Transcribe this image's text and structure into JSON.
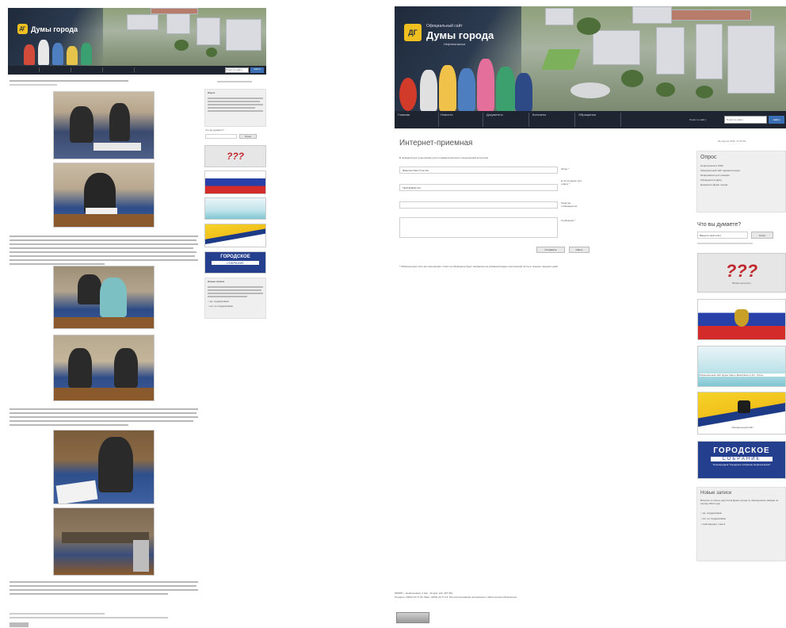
{
  "left": {
    "header": {
      "title": "Думы города",
      "logo_text": "ДГ"
    },
    "nav": {
      "search_placeholder": "Поиск по сайту",
      "search_button": "Найти"
    },
    "sidebar": {
      "block1_title": "Опрос",
      "poll_title": "Что вы думаете?",
      "poll_button": "Голос",
      "ad_question": "???",
      "ad_city_line1": "ГОРОДСКОЕ",
      "ad_city_line2": "СОБРАНИЕ",
      "news_title": "Новые записи",
      "radio_1": "да, поддерживаю",
      "radio_2": "нет, не поддерживаю"
    }
  },
  "right": {
    "header": {
      "subtitle": "Официальный сайт",
      "title": "Думы города",
      "sub2": "Нефтеюганска",
      "logo_text": "ДГ"
    },
    "nav": {
      "items": [
        "Главная",
        "Новости",
        "Документы",
        "Контакты",
        "Обращения"
      ],
      "search_label": "Поиск по сайту:",
      "search_placeholder": "Поиск по сайту",
      "search_button": "Найти"
    },
    "page": {
      "title": "Интернет-приемная",
      "date": "03 апреля 2015, 17:45:36",
      "intro": "В приемной доступны формы для отправки вопросов и предложений депутатам",
      "field_name_value": "Фамилия Имя Отчество",
      "field_email_value": "TEXT@MAIL.RU",
      "label_name": "Автор *",
      "label_email": "Е-почта адрес для ответа *",
      "label_subject": "Тема (не отображается)",
      "label_message": "Сообщение *",
      "btn_send": "Отправить",
      "btn_reset": "Сброс",
      "note": "* Обязательные поля для заполнения. Ответ на обращение будет направлен на указанный адрес электронной почты в течение тридцати дней."
    },
    "sidebar": {
      "block1_title": "Опрос",
      "block1_items": [
        "Нефтеюганск в СМИ",
        "Официальный сайт администрации",
        "Информация для граждан",
        "Обращения в Думу",
        "Документы Думы города"
      ],
      "poll_title": "Что вы думаете?",
      "poll_placeholder": "Введите свой ответ",
      "poll_button": "Голос",
      "ad_question": "???",
      "ad_question_caption": "Вопрос депутату",
      "ad_sky_caption": "Официальный сайт Думы Ханты-Мансийского АО - Югры",
      "ad_gold_caption": "Официальный сайт",
      "ad_city_line1": "ГОРОДСКОЕ",
      "ad_city_line2": "СОБРАНИЕ",
      "ad_city_caption": "Телепередача \"Городское Собрание Нефтеюганска\"",
      "news_title": "Новые записи",
      "news_text": "Вопросы и ответы депутатов Думы города по обращениям граждан за период 2014 года.",
      "radio_1": "да, поддерживаю",
      "radio_2": "нет, не поддерживаю",
      "radio_3": "свой вариант ответа"
    },
    "footer": {
      "line1": "628305, г. Нефтеюганск, 2 мкр., 22 дом, каб. 307-310",
      "line2": "Телефон: (3463) 23-77-06, Факс: (3463) 23-77-14. При использовании материалов с сайта ссылка обязательна."
    }
  }
}
